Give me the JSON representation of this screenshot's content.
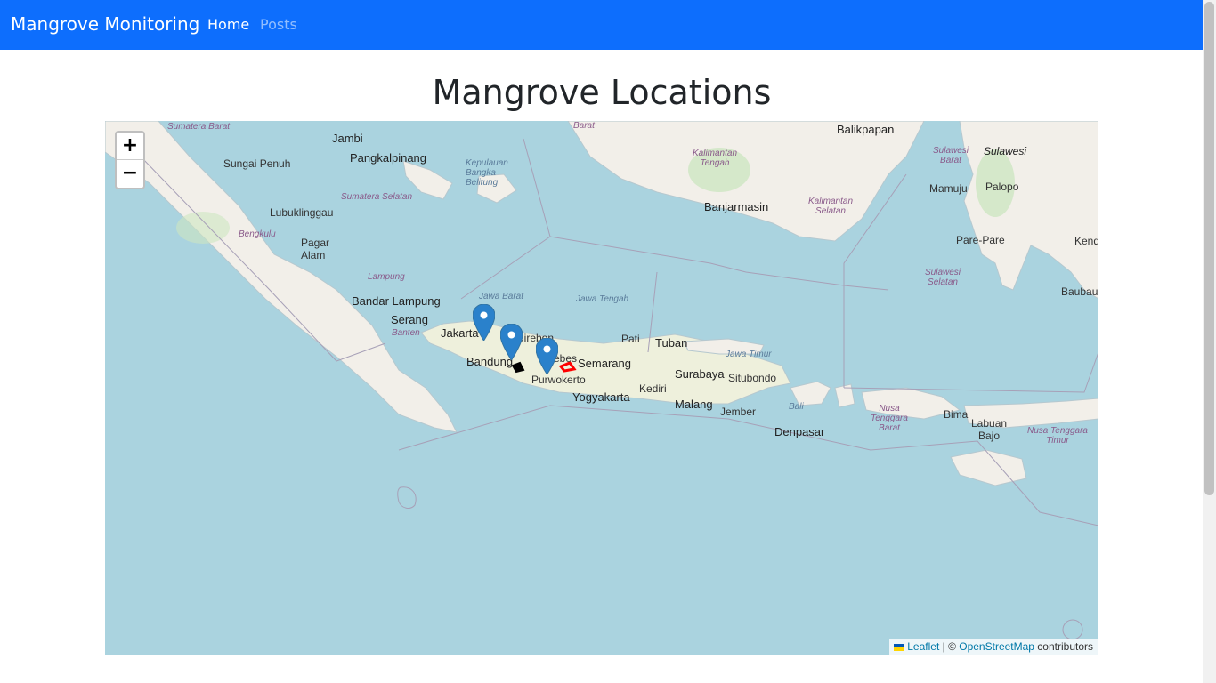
{
  "navbar": {
    "brand": "Mangrove Monitoring",
    "links": [
      {
        "label": "Home",
        "active": true
      },
      {
        "label": "Posts",
        "active": false
      }
    ],
    "color": "#0d6efd"
  },
  "page": {
    "title": "Mangrove Locations"
  },
  "map": {
    "zoom_in_label": "+",
    "zoom_out_label": "−",
    "attribution": {
      "leaflet": "Leaflet",
      "separator": " | © ",
      "osm": "OpenStreetMap",
      "suffix": " contributors"
    },
    "water_color": "#aad3df",
    "land_color": "#f2efe9",
    "marker_color": "#2a81cb",
    "marker_count": 3,
    "polygon_colors": [
      "#000000",
      "#ff0000"
    ],
    "labels": {
      "sumatera_barat": "Sumatera Barat",
      "jambi": "Jambi",
      "sungai_penuh": "Sungai Penuh",
      "pangkalpinang": "Pangkalpinang",
      "kep_babel": "Kepulauan Bangka Belitung",
      "sumatera_selatan": "Sumatera Selatan",
      "lubuklinggau": "Lubuklinggau",
      "bengkulu": "Bengkulu",
      "pagar_alam": "Pagar Alam",
      "lampung": "Lampung",
      "bandar_lampung": "Bandar Lampung",
      "serang": "Serang",
      "banten": "Banten",
      "jakarta": "Jakarta",
      "bandung": "Bandung",
      "cirebon": "Cirebon",
      "brebes": "Brebes",
      "purwokerto": "Purwokerto",
      "semarang": "Semarang",
      "yogyakarta": "Yogyakarta",
      "pati": "Pati",
      "tuban": "Tuban",
      "surabaya": "Surabaya",
      "kediri": "Kediri",
      "malang": "Malang",
      "jember": "Jember",
      "situbondo": "Situbondo",
      "jawa_barat": "Jawa Barat",
      "jawa_tengah": "Jawa Tengah",
      "jawa_timur": "Jawa Timur",
      "bali": "Bali",
      "denpasar": "Denpasar",
      "ntb": "Nusa Tenggara Barat",
      "bima": "Bima",
      "labuan_bajo": "Labuan Bajo",
      "ntt": "Nusa Tenggara Timur",
      "balikpapan": "Balikpapan",
      "kalimantan_tengah": "Kalimantan Tengah",
      "kalimantan_selatan": "Kalimantan Selatan",
      "banjarmasin": "Banjarmasin",
      "kalbar_partial": "Barat",
      "sulawesi": "Sulawesi",
      "sulawesi_barat": "Sulawesi Barat",
      "mamuju": "Mamuju",
      "palopo": "Palopo",
      "pare_pare": "Pare-Pare",
      "sulawesi_selatan": "Sulawesi Selatan",
      "kendari_partial": "Kend",
      "baubau": "Baubau"
    }
  }
}
